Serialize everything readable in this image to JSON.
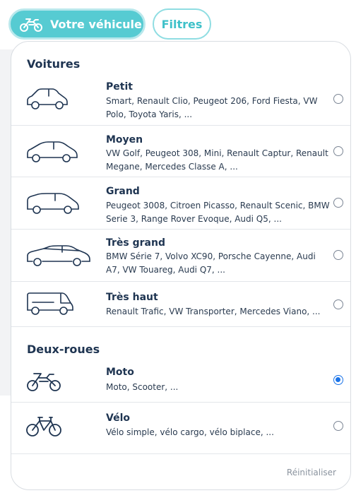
{
  "header": {
    "vehicle_button": {
      "label": "Votre véhicule",
      "icon": "motorcycle-icon"
    },
    "filters_button": {
      "label": "Filtres"
    }
  },
  "sections": [
    {
      "title": "Voitures",
      "items": [
        {
          "icon": "small-car-icon",
          "label": "Petit",
          "description": "Smart, Renault Clio, Peugeot 206, Ford Fiesta, VW Polo, Toyota Yaris, ...",
          "selected": false
        },
        {
          "icon": "medium-car-icon",
          "label": "Moyen",
          "description": "VW Golf, Peugeot 308, Mini, Renault Captur, Renault Megane, Mercedes Classe A, ...",
          "selected": false
        },
        {
          "icon": "large-car-icon",
          "label": "Grand",
          "description": "Peugeot 3008, Citroen Picasso, Renault Scenic, BMW Serie 3, Range Rover Evoque, Audi Q5, ...",
          "selected": false
        },
        {
          "icon": "very-large-car-icon",
          "label": "Très grand",
          "description": "BMW Série 7, Volvo XC90, Porsche Cayenne, Audi A7, VW Touareg, Audi Q7, ...",
          "selected": false
        },
        {
          "icon": "van-icon",
          "label": "Très haut",
          "description": "Renault Trafic, VW Transporter, Mercedes Viano, ...",
          "selected": false
        }
      ]
    },
    {
      "title": "Deux-roues",
      "items": [
        {
          "icon": "motorcycle-icon",
          "label": "Moto",
          "description": "Moto, Scooter, ...",
          "selected": true
        },
        {
          "icon": "bicycle-icon",
          "label": "Vélo",
          "description": "Vélo simple, vélo cargo, vélo biplace, ...",
          "selected": false
        }
      ]
    }
  ],
  "footer": {
    "reset_label": "Réinitialiser"
  },
  "colors": {
    "accent": "#56cbd2",
    "text": "#1e3451",
    "radio_selected": "#1a73e8"
  }
}
